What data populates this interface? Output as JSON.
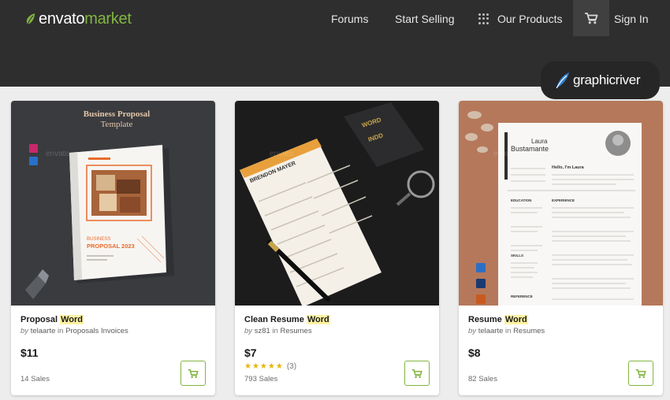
{
  "header": {
    "logo_envato": "envato",
    "logo_market": "market",
    "nav": {
      "forums": "Forums",
      "start_selling": "Start Selling",
      "our_products": "Our Products",
      "sign_in": "Sign In"
    }
  },
  "badge": {
    "text": "graphicriver"
  },
  "colors": {
    "header_bg": "#2e2e2e",
    "brand_green": "#82b541",
    "highlight": "#fdf3a3",
    "star": "#e8b400"
  },
  "cards": [
    {
      "thumbnail": {
        "headline_1": "Business Proposal",
        "headline_2": "Template",
        "cover_line_1": "BUSINESS",
        "cover_line_2": "PROPOSAL 2023",
        "watermark": "envato"
      },
      "title_prefix": "Proposal ",
      "title_highlight": "Word",
      "title_suffix": "",
      "by": "by",
      "author": "telaarte",
      "in": "in",
      "category": "Proposals Invoices",
      "price": "$11",
      "sales": "14 Sales"
    },
    {
      "thumbnail": {
        "resume_name": "BRENDON MAYER",
        "book_line_1": "WORD",
        "book_line_2": "INDD",
        "watermark": "envato"
      },
      "title_prefix": "Clean Resume ",
      "title_highlight": "Word",
      "title_suffix": "",
      "by": "by",
      "author": "sz81",
      "in": "in",
      "category": "Resumes",
      "price": "$7",
      "rating": {
        "stars": 5,
        "star_text": "★★★★★",
        "count_label": "(3)"
      },
      "sales": "793 Sales"
    },
    {
      "thumbnail": {
        "first_name": "Laura",
        "last_name": "Bustamante",
        "greeting": "Hello, I'm Laura",
        "section_education": "EDUCATION",
        "section_experience": "EXPERIENCE",
        "section_skills": "SKILLS",
        "section_reference": "REFERENCE",
        "watermark": "envato"
      },
      "title_prefix": "Resume ",
      "title_highlight": "Word",
      "title_suffix": "",
      "by": "by",
      "author": "telaarte",
      "in": "in",
      "category": "Resumes",
      "price": "$8",
      "sales": "82 Sales"
    }
  ],
  "icons": {
    "cart": "shopping-cart-icon",
    "grid": "grid-dots-icon",
    "leaf": "envato-leaf-icon"
  }
}
